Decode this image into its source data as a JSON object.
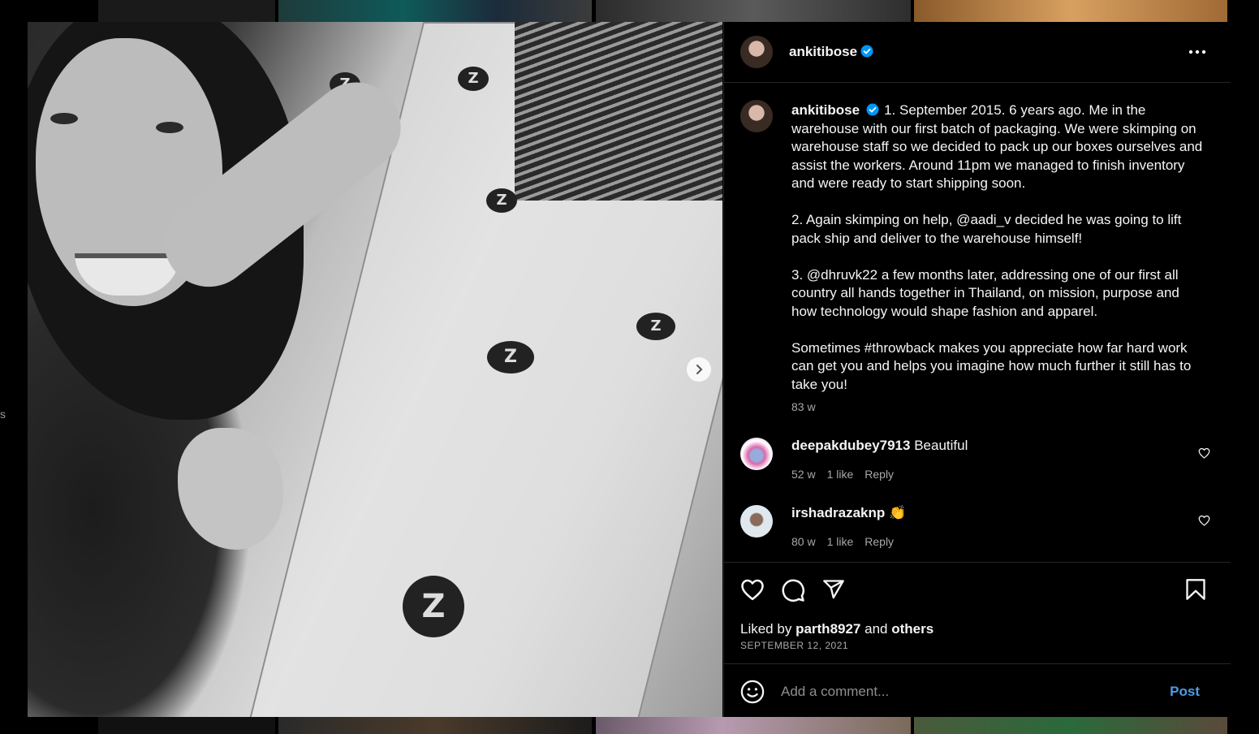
{
  "post": {
    "author": "ankitibose",
    "verified": true,
    "caption_username": "ankitibose",
    "caption": "1. September 2015. 6 years ago. Me in the warehouse with our first batch of packaging. We were skimping on warehouse staff so we decided to pack up our boxes ourselves and assist the workers. Around 11pm we managed to finish inventory and were ready to start shipping soon.\n\n2. Again skimping on help, @aadi_v decided he was going to lift pack ship and deliver to the warehouse himself!\n\n3. @dhruvk22 a few months later, addressing one of our first all country all hands together in Thailand, on mission, purpose and how technology would shape fashion and apparel.\n\nSometimes #throwback makes you appreciate how far hard work can get you and helps you imagine how much further it still has to take you!",
    "caption_age": "83 w",
    "liked_prefix": "Liked by",
    "liked_user": "parth8927",
    "liked_and": "and",
    "liked_others": "others",
    "date": "SEPTEMBER 12, 2021",
    "carousel": {
      "count": 3,
      "active_index": 0
    },
    "media_logo_text": "Z"
  },
  "comments": [
    {
      "username": "deepakdubey7913",
      "text": "Beautiful",
      "age": "52 w",
      "likes": "1 like",
      "reply": "Reply"
    },
    {
      "username": "irshadrazaknp",
      "text": "👏",
      "age": "80 w",
      "likes": "1 like",
      "reply": "Reply"
    }
  ],
  "add_comment": {
    "placeholder": "Add a comment...",
    "post_label": "Post"
  },
  "side_text": "s",
  "icons": {
    "verified": "verified-badge-icon",
    "more": "more-options-icon",
    "like": "heart-icon",
    "comment": "comment-icon",
    "share": "share-icon",
    "save": "bookmark-icon",
    "emoji": "emoji-icon",
    "next": "chevron-right-icon"
  },
  "colors": {
    "accent": "#4a9ee6",
    "verified": "#0095f6",
    "background": "#000000",
    "muted": "#a8a8a8"
  }
}
